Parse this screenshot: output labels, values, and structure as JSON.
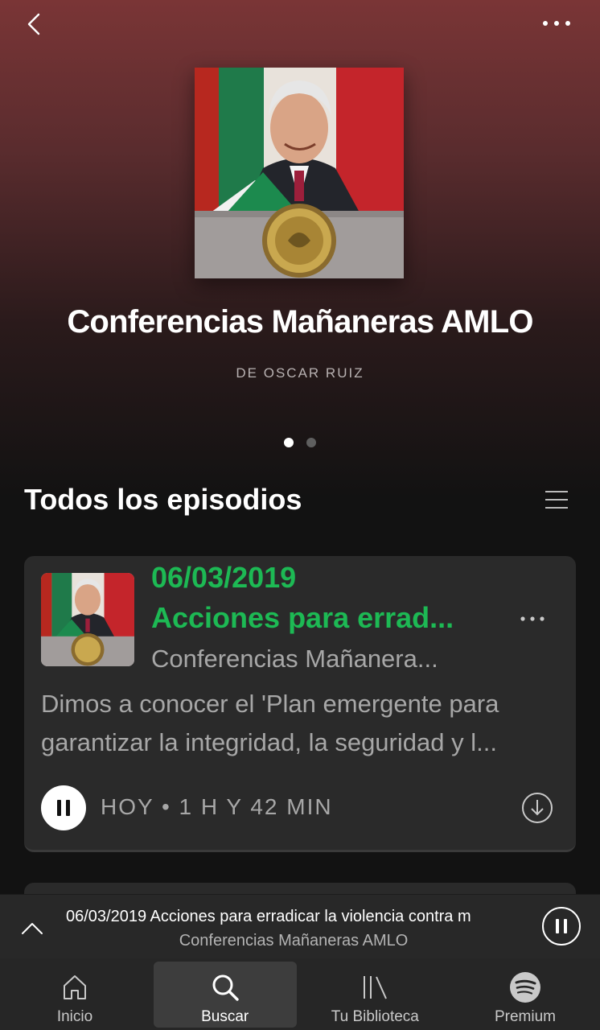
{
  "podcast": {
    "title": "Conferencias Mañaneras AMLO",
    "author": "DE OSCAR RUIZ"
  },
  "pager": {
    "pages": 2,
    "active_index": 0
  },
  "episodes_section": {
    "title": "Todos los episodios"
  },
  "episode": {
    "date": "06/03/2019",
    "title": "Acciones para errad...",
    "show": "Conferencias Mañanera...",
    "description": "Dimos a conocer el 'Plan emergente para garantizar la integridad, la seguridad y l...",
    "meta": "HOY • 1 H Y 42 MIN"
  },
  "now_playing": {
    "track": "06/03/2019 Acciones para erradicar la violencia contra m",
    "show": "Conferencias Mañaneras AMLO"
  },
  "tabs": [
    {
      "label": "Inicio",
      "icon": "home-icon",
      "active": false
    },
    {
      "label": "Buscar",
      "icon": "search-icon",
      "active": true
    },
    {
      "label": "Tu Biblioteca",
      "icon": "library-icon",
      "active": false
    },
    {
      "label": "Premium",
      "icon": "spotify-icon",
      "active": false
    }
  ],
  "colors": {
    "accent": "#1db954",
    "header_top": "#7a3536",
    "background": "#121212",
    "card": "#2a2a2a"
  }
}
